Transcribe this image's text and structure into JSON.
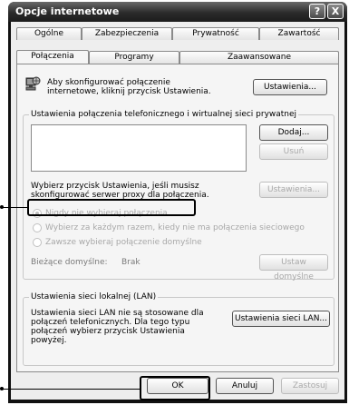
{
  "window": {
    "title": "Opcje internetowe",
    "help_glyph": "?",
    "close_glyph": "X"
  },
  "tabs_row1": [
    "Ogólne",
    "Zabezpieczenia",
    "Prywatność",
    "Zawartość"
  ],
  "tabs_row2": [
    "Połączenia",
    "Programy",
    "Zaawansowane"
  ],
  "active_tab": "Połączenia",
  "setup": {
    "text_line1": "Aby skonfigurować połączenie",
    "text_line2": "internetowe, kliknij przycisk Ustawienia.",
    "button": "Ustawienia..."
  },
  "dialup_group": {
    "legend": "Ustawienia połączenia telefonicznego i wirtualnej sieci prywatnej",
    "add_button": "Dodaj...",
    "remove_button": "Usuń",
    "proxy_text_line1": "Wybierz przycisk Ustawienia, jeśli musisz",
    "proxy_text_line2": "skonfigurować serwer proxy dla połączenia.",
    "settings_button": "Ustawienia...",
    "radios": [
      {
        "label": "Nigdy nie wybieraj połączenia",
        "checked": true
      },
      {
        "label": "Wybierz za każdym razem, kiedy nie ma połączenia sieciowego",
        "checked": false
      },
      {
        "label": "Zawsze wybieraj połączenie domyślne",
        "checked": false
      }
    ],
    "current_default_label": "Bieżące domyślne:",
    "current_default_value": "Brak",
    "set_default_button": "Ustaw domyślne"
  },
  "lan_group": {
    "legend": "Ustawienia sieci lokalnej (LAN)",
    "text_line1": "Ustawienia sieci LAN nie są stosowane dla",
    "text_line2": "połączeń telefonicznych. Dla tego typu",
    "text_line3": "połączeń wybierz przycisk Ustawienia",
    "text_line4": "powyżej.",
    "button": "Ustawienia sieci LAN..."
  },
  "footer": {
    "ok": "OK",
    "cancel": "Anuluj",
    "apply": "Zastosuj"
  }
}
